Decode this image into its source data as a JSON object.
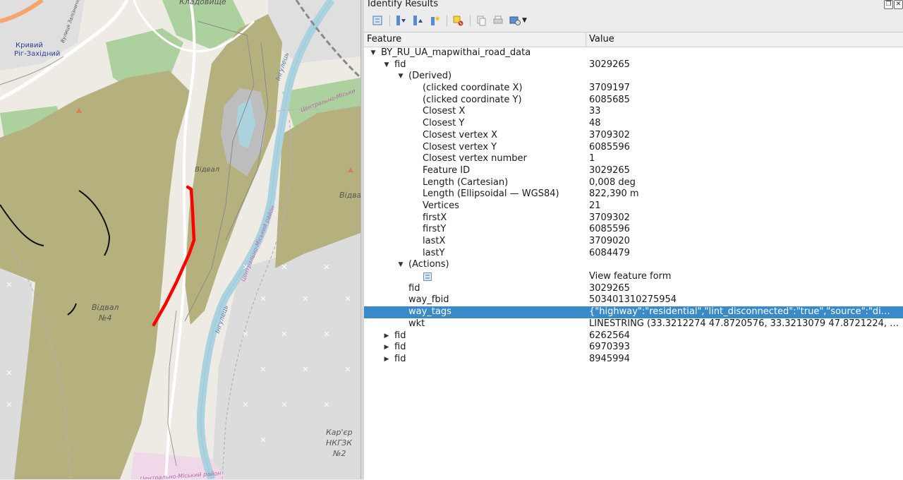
{
  "map": {
    "labels": {
      "kladovyshche": "Кладовище",
      "kryvyi_rih": "Кривий",
      "kryvyi_rih_west": "Ріг-Західний",
      "videal": "Відвал",
      "videal_right": "Відвал",
      "videal_no4_line1": "Відвал",
      "videal_no4_line2": "№4",
      "inhulets_1": "Інгулець",
      "inhulets_2": "Інгулець",
      "tsentralno_1": "Центрально-Міськи",
      "tsentralno_2": "Центрально-Міський район",
      "tsentralno_3": "Центрально-Міський район",
      "rail_label": "Вулиця Залізнична",
      "karier_line1": "Кар'єр",
      "karier_line2": "НКГЗК",
      "karier_line3": "№2"
    }
  },
  "panel": {
    "title": "Identify Results",
    "columns": {
      "feature": "Feature",
      "value": "Value"
    },
    "rows": [
      {
        "level": 0,
        "expander": "open",
        "feature": "BY_RU_UA_mapwithai_road_data",
        "value": ""
      },
      {
        "level": 1,
        "expander": "open",
        "feature": "fid",
        "value": "3029265"
      },
      {
        "level": 2,
        "expander": "open",
        "feature": "(Derived)",
        "value": ""
      },
      {
        "level": 3,
        "expander": "none",
        "feature": "(clicked coordinate X)",
        "value": "3709197"
      },
      {
        "level": 3,
        "expander": "none",
        "feature": "(clicked coordinate Y)",
        "value": "6085685"
      },
      {
        "level": 3,
        "expander": "none",
        "feature": "Closest X",
        "value": "33"
      },
      {
        "level": 3,
        "expander": "none",
        "feature": "Closest Y",
        "value": "48"
      },
      {
        "level": 3,
        "expander": "none",
        "feature": "Closest vertex X",
        "value": "3709302"
      },
      {
        "level": 3,
        "expander": "none",
        "feature": "Closest vertex Y",
        "value": "6085596"
      },
      {
        "level": 3,
        "expander": "none",
        "feature": "Closest vertex number",
        "value": "1"
      },
      {
        "level": 3,
        "expander": "none",
        "feature": "Feature ID",
        "value": "3029265"
      },
      {
        "level": 3,
        "expander": "none",
        "feature": "Length (Cartesian)",
        "value": "0,008 deg"
      },
      {
        "level": 3,
        "expander": "none",
        "feature": "Length (Ellipsoidal — WGS84)",
        "value": "822,390 m"
      },
      {
        "level": 3,
        "expander": "none",
        "feature": "Vertices",
        "value": "21"
      },
      {
        "level": 3,
        "expander": "none",
        "feature": "firstX",
        "value": "3709302"
      },
      {
        "level": 3,
        "expander": "none",
        "feature": "firstY",
        "value": "6085596"
      },
      {
        "level": 3,
        "expander": "none",
        "feature": "lastX",
        "value": "3709020"
      },
      {
        "level": 3,
        "expander": "none",
        "feature": "lastY",
        "value": "6084479"
      },
      {
        "level": 2,
        "expander": "open",
        "feature": "(Actions)",
        "value": ""
      },
      {
        "level": 3,
        "expander": "icon",
        "feature": "",
        "value": "View feature form"
      },
      {
        "level": 2,
        "expander": "none",
        "feature": "fid",
        "value": "3029265"
      },
      {
        "level": 2,
        "expander": "none",
        "feature": "way_fbid",
        "value": "503401310275954"
      },
      {
        "level": 2,
        "expander": "none",
        "feature": "way_tags",
        "value": "{\"highway\":\"residential\",\"lint_disconnected\":\"true\",\"source\":\"di…",
        "selected": true
      },
      {
        "level": 2,
        "expander": "none",
        "feature": "wkt",
        "value": "LINESTRING (33.3212274 47.8720576, 33.3213079 47.8721224, …"
      },
      {
        "level": 1,
        "expander": "closed",
        "feature": "fid",
        "value": "6262564"
      },
      {
        "level": 1,
        "expander": "closed",
        "feature": "fid",
        "value": "6970393"
      },
      {
        "level": 1,
        "expander": "closed",
        "feature": "fid",
        "value": "8945994"
      }
    ]
  }
}
